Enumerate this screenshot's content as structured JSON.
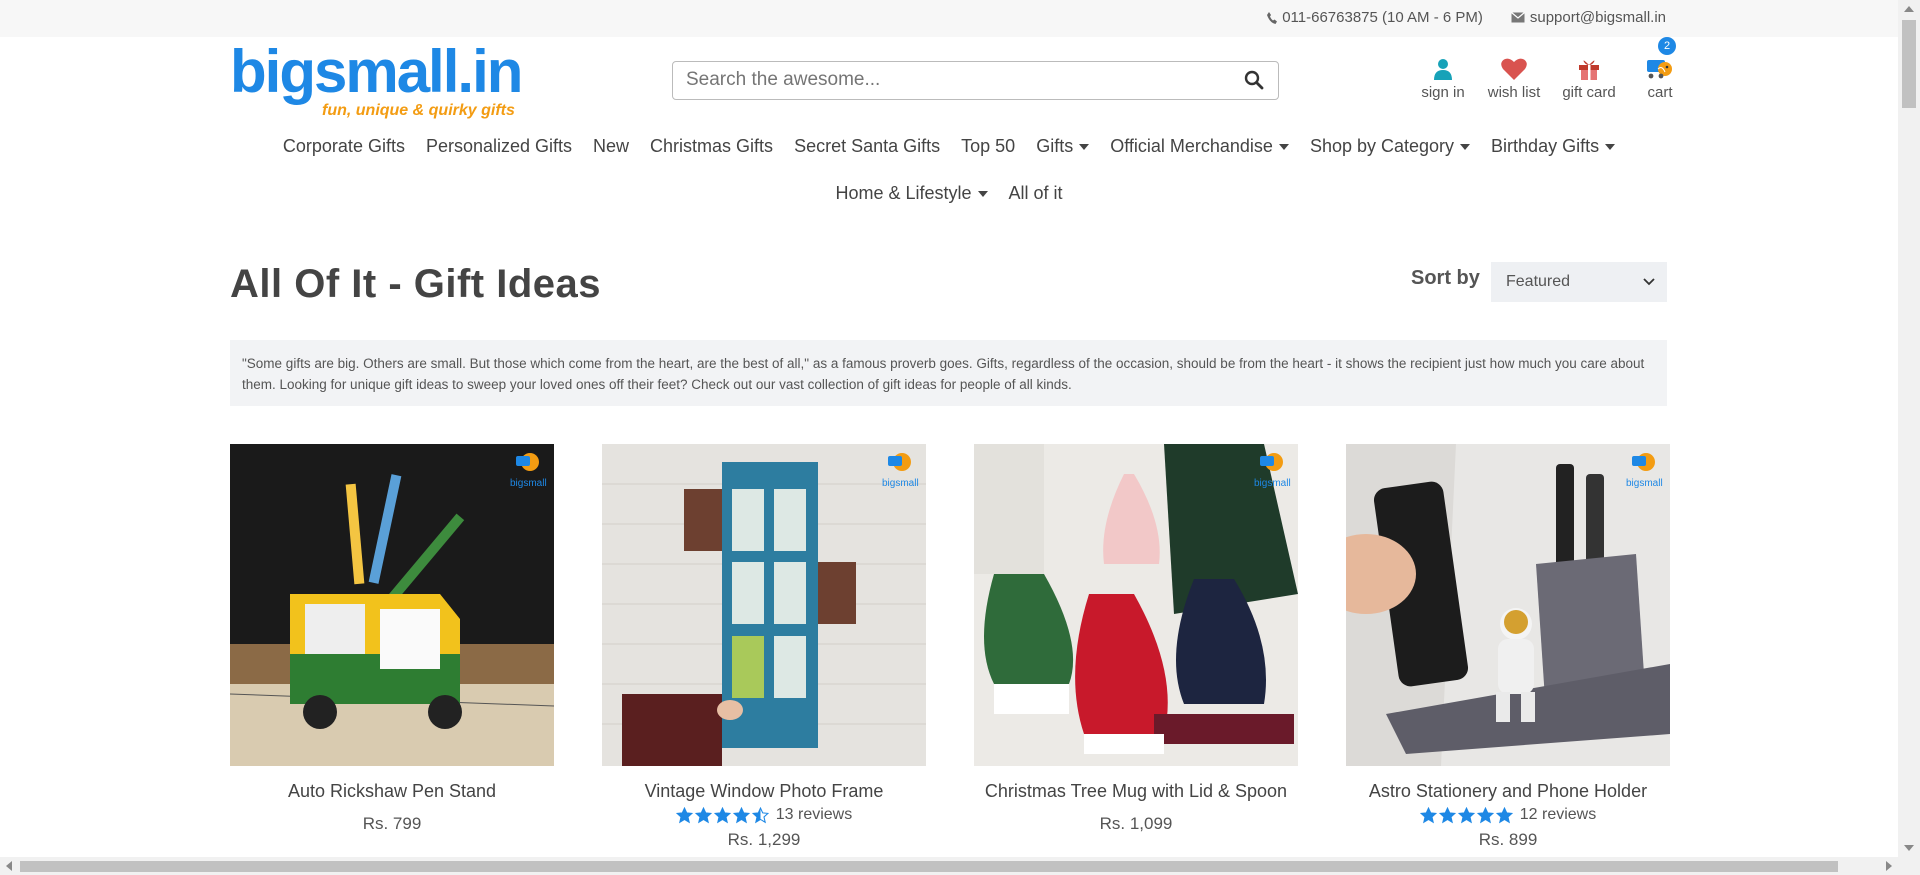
{
  "topbar": {
    "phone": "011-66763875 (10 AM - 6 PM)",
    "email": "support@bigsmall.in"
  },
  "logo": {
    "name": "bigsmall.in",
    "tagline": "fun, unique & quirky gifts"
  },
  "search": {
    "placeholder": "Search the awesome..."
  },
  "header_links": {
    "sign_in": "sign in",
    "wish_list": "wish list",
    "gift_card": "gift card",
    "cart": "cart",
    "cart_count": "2"
  },
  "nav": {
    "row1": [
      "Corporate Gifts",
      "Personalized Gifts",
      "New",
      "Christmas Gifts",
      "Secret Santa Gifts",
      "Top 50",
      "Gifts",
      "Official Merchandise",
      "Shop by Category",
      "Birthday Gifts"
    ],
    "row2": [
      "Home & Lifestyle",
      "All of it"
    ]
  },
  "page": {
    "title": "All Of It - Gift Ideas",
    "sort_label": "Sort by",
    "sort_value": "Featured",
    "description": "\"Some gifts are big. Others are small. But those which come from the heart, are the best of all,\" as a famous proverb goes. Gifts, regardless of the occasion, should be from the heart - it shows the recipient just how much you care about them. Looking for unique gift ideas to sweep your loved ones off their feet? Check out our vast collection of gift ideas for people of all kinds."
  },
  "products": [
    {
      "name": "Auto Rickshaw Pen Stand",
      "price": "Rs. 799",
      "reviews": "",
      "stars": 0
    },
    {
      "name": "Vintage Window Photo Frame",
      "price": "Rs. 1,299",
      "reviews": "13 reviews",
      "stars": 4.5
    },
    {
      "name": "Christmas Tree Mug with Lid & Spoon",
      "price": "Rs. 1,099",
      "reviews": "",
      "stars": 0
    },
    {
      "name": "Astro Stationery and Phone Holder",
      "price": "Rs. 899",
      "reviews": "12 reviews",
      "stars": 5
    }
  ],
  "colors": {
    "brand_blue": "#1e88e5",
    "brand_orange": "#f39c12",
    "wishlist_red": "#d9534f",
    "star_blue": "#1e88e5"
  }
}
